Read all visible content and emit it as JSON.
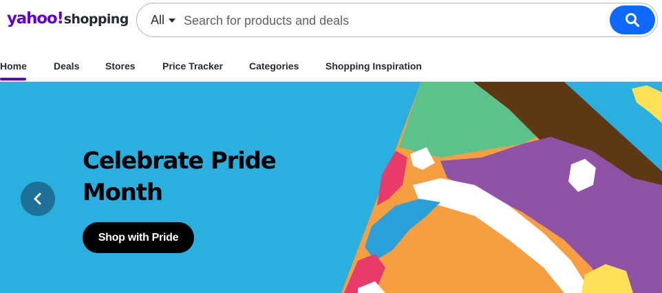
{
  "header": {
    "logo": {
      "primary": "yahoo!",
      "secondary": "shopping"
    },
    "search": {
      "category": "All",
      "placeholder": "Search for products and deals",
      "value": ""
    }
  },
  "nav": {
    "items": [
      {
        "label": "Home",
        "active": true
      },
      {
        "label": "Deals"
      },
      {
        "label": "Stores"
      },
      {
        "label": "Price Tracker"
      },
      {
        "label": "Categories"
      },
      {
        "label": "Shopping Inspiration"
      }
    ]
  },
  "hero": {
    "title_line1": "Celebrate Pride",
    "title_line2": "Month",
    "cta_label": "Shop with Pride"
  },
  "colors": {
    "brand_purple": "#6001d2",
    "search_button": "#0f69ff",
    "hero_background": "#29afe0",
    "prev_button": "#1d7096"
  },
  "icons": {
    "search": "search-icon",
    "chevron": "chevron-left-icon",
    "caret": "caret-down-icon"
  }
}
